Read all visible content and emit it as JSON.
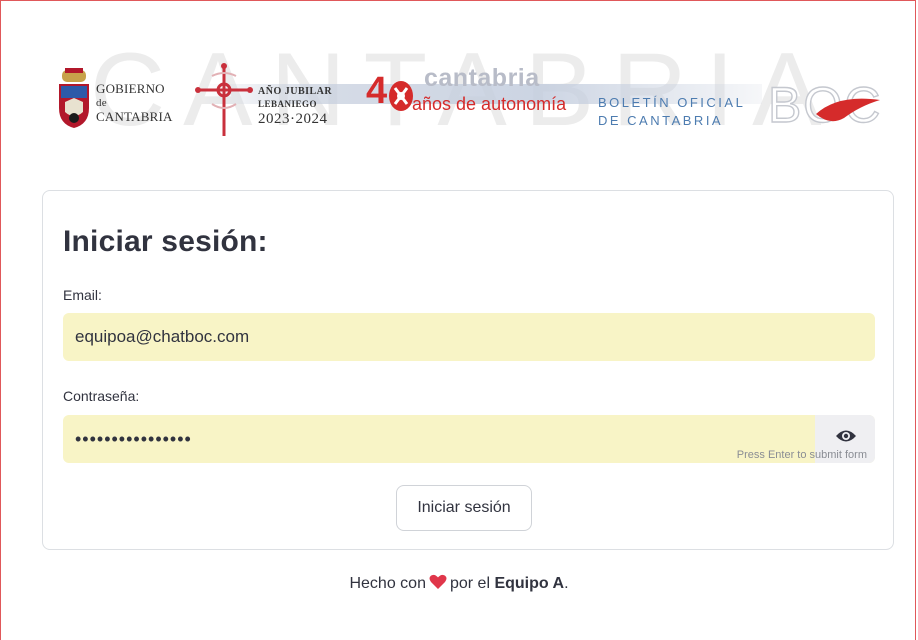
{
  "banner": {
    "watermark": "CANTABRIA",
    "gobierno": {
      "line1": "GOBIERNO",
      "line2": "de",
      "line3": "CANTABRIA"
    },
    "ano_jubilar": {
      "line1": "AÑO JUBILAR",
      "line2": "LEBANIEGO",
      "line3": "2023·2024"
    },
    "autonomia": {
      "number": "4",
      "word": "cantabria",
      "sub": "años de autonomía"
    },
    "boletin": {
      "line1": "BOLETÍN OFICIAL",
      "line2": "DE CANTABRIA"
    },
    "boc_logo": "BOC"
  },
  "form": {
    "title": "Iniciar sesión:",
    "email_label": "Email:",
    "email_value": "equipoa@chatboc.com",
    "password_label": "Contraseña:",
    "password_value": "••••••••••••••••",
    "hint": "Press Enter to submit form",
    "submit_label": "Iniciar sesión"
  },
  "footer": {
    "prefix": "Hecho con",
    "middle": "por el",
    "team": "Equipo A",
    "suffix": "."
  },
  "colors": {
    "input_bg": "#f8f4c6",
    "heart": "#e0364a",
    "accent_red": "#d52b2b",
    "boc_blue": "#4d7cb0"
  },
  "icons": {
    "visibility_toggle": "eye-icon",
    "footer_heart": "heart-icon"
  }
}
